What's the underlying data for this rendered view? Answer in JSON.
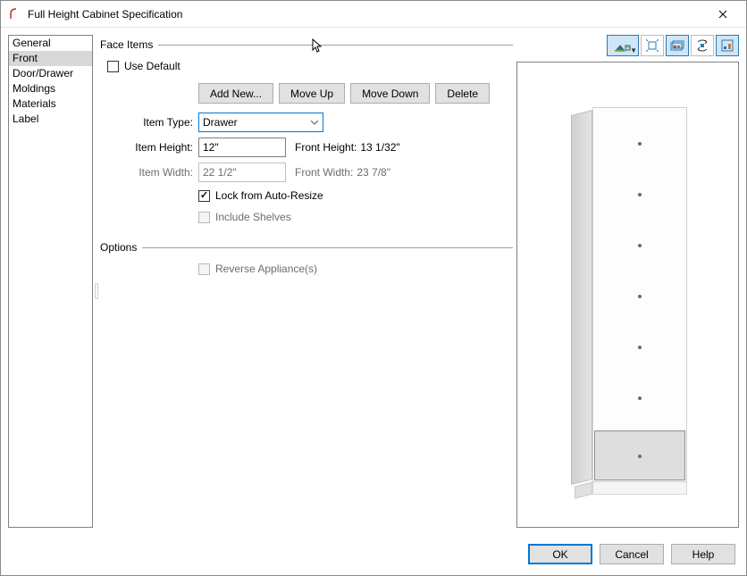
{
  "window": {
    "title": "Full Height Cabinet Specification"
  },
  "sidebar": {
    "items": [
      {
        "label": "General"
      },
      {
        "label": "Front"
      },
      {
        "label": "Door/Drawer"
      },
      {
        "label": "Moldings"
      },
      {
        "label": "Materials"
      },
      {
        "label": "Label"
      }
    ],
    "selected_index": 1
  },
  "face_items": {
    "header": "Face Items",
    "use_default_label": "Use Default",
    "use_default_checked": false,
    "buttons": {
      "add_new": "Add New...",
      "move_up": "Move Up",
      "move_down": "Move Down",
      "delete": "Delete"
    },
    "item_type": {
      "label": "Item Type:",
      "value": "Drawer"
    },
    "item_height": {
      "label": "Item Height:",
      "value": "12\"",
      "front_label": "Front Height:",
      "front_value": "13 1/32\""
    },
    "item_width": {
      "label": "Item Width:",
      "value": "22 1/2\"",
      "front_label": "Front Width:",
      "front_value": "23 7/8\""
    },
    "lock_auto_resize": {
      "label": "Lock from Auto-Resize",
      "checked": true
    },
    "include_shelves": {
      "label": "Include Shelves",
      "checked": false,
      "enabled": false
    }
  },
  "options": {
    "header": "Options",
    "reverse_appliances": {
      "label": "Reverse Appliance(s)",
      "checked": false,
      "enabled": false
    }
  },
  "toolbar_icons": [
    "view-mode-icon",
    "fullscreen-icon",
    "color-toggle-icon",
    "rotate-icon",
    "final-view-icon"
  ],
  "footer": {
    "ok": "OK",
    "cancel": "Cancel",
    "help": "Help"
  },
  "colors": {
    "accent": "#0078d7",
    "selected_row": "#d8d8d8"
  }
}
